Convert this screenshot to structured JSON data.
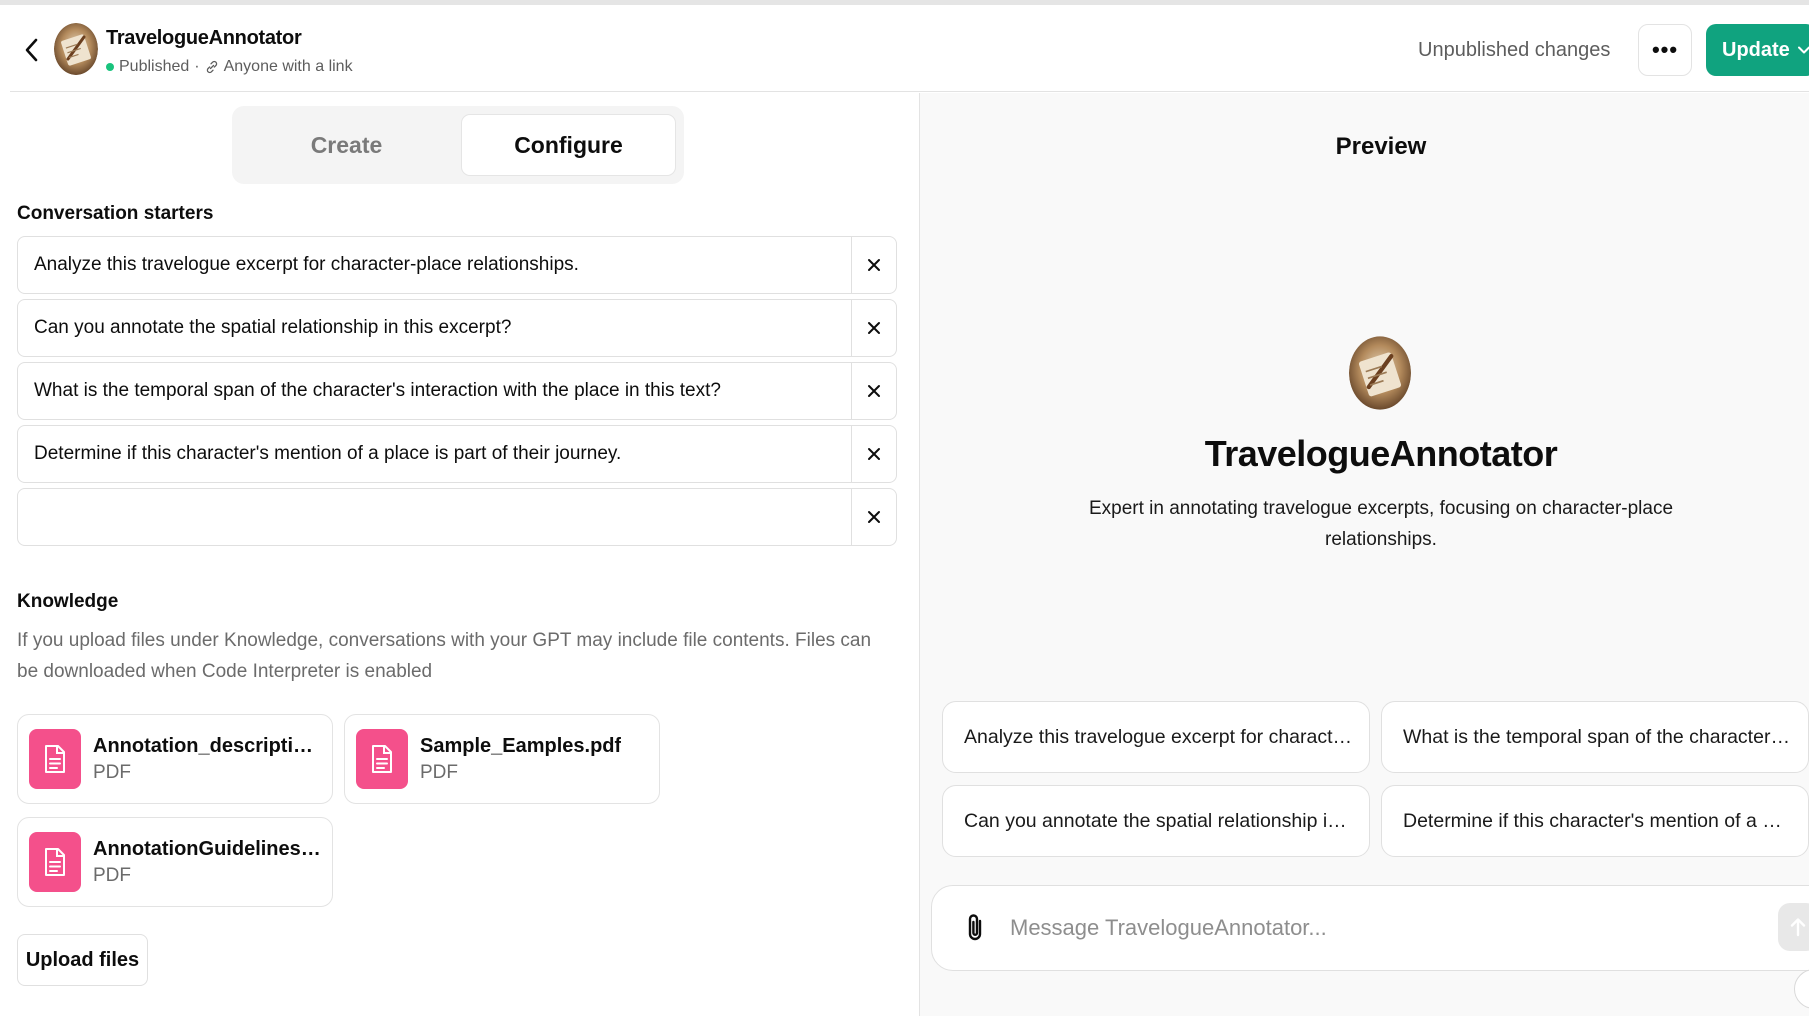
{
  "header": {
    "gpt_name": "TravelogueAnnotator",
    "status": "Published",
    "separator": "·",
    "visibility": "Anyone with a link",
    "unpublished_label": "Unpublished changes",
    "more_label": "•••",
    "update_label": "Update",
    "icons": {
      "back": "chevron-left-icon",
      "link": "link-icon",
      "more": "ellipsis-icon",
      "update_caret": "chevron-down-icon"
    }
  },
  "tabs": [
    {
      "label": "Create",
      "active": false
    },
    {
      "label": "Configure",
      "active": true
    }
  ],
  "configure": {
    "conversation_starters_label": "Conversation starters",
    "starters": [
      "Analyze this travelogue excerpt for character-place relationships.",
      "Can you annotate the spatial relationship in this excerpt?",
      "What is the temporal span of the character's interaction with the place in this text?",
      "Determine if this character's mention of a place is part of their journey.",
      ""
    ],
    "knowledge_label": "Knowledge",
    "knowledge_help": "If you upload files under Knowledge, conversations with your GPT may include file contents. Files can be downloaded when Code Interpreter is enabled",
    "files": [
      {
        "name": "Annotation_description_Fi...",
        "type": "PDF"
      },
      {
        "name": "Sample_Eamples.pdf",
        "type": "PDF"
      },
      {
        "name": "AnnotationGuidelines-Fin...",
        "type": "PDF"
      }
    ],
    "upload_label": "Upload files"
  },
  "preview": {
    "title": "Preview",
    "gpt_name": "TravelogueAnnotator",
    "description": "Expert in annotating travelogue excerpts, focusing on character-place relationships.",
    "suggestions": [
      "Analyze this travelogue excerpt for character-...",
      "What is the temporal span of the character's i...",
      "Can you annotate the spatial relationship in th...",
      "Determine if this character's mention of a plac..."
    ],
    "message_placeholder": "Message TravelogueAnnotator...",
    "help_label": "?"
  },
  "colors": {
    "accent": "#10a37f",
    "status_dot": "#19c37d",
    "file_icon": "#f4508b"
  }
}
